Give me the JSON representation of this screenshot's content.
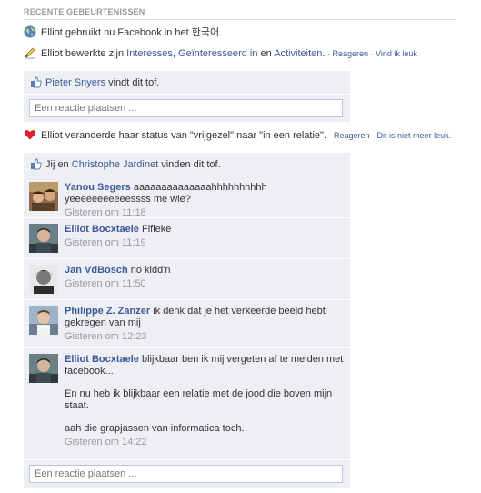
{
  "header": {
    "title": "RECENTE GEBEURTENISSEN"
  },
  "stories": {
    "facebook_language": {
      "text": "Elliot gebruikt nu Facebook in het 한국어."
    },
    "edit_interests": {
      "prefix": "Elliot bewerkte zijn ",
      "link1": "Interesses",
      "sep1": ", ",
      "link2": "Geïnteresseerd in",
      "sep2": " en ",
      "link3": "Activiteiten",
      "end": ".",
      "dot1": " · ",
      "action1": "Reageren",
      "dot2": " · ",
      "action2": "Vind ik leuk"
    },
    "relationship": {
      "text": "Elliot veranderde haar status van \"vrijgezel\" naar \"in een relatie\".",
      "dot1": " · ",
      "action1": "Reageren",
      "dot2": " · ",
      "action2": "Dit is niet meer leuk."
    }
  },
  "ufi1": {
    "like_name": "Pieter Snyers",
    "like_suffix": " vindt dit tof.",
    "input_placeholder": "Een reactie plaatsen ..."
  },
  "ufi2": {
    "like_prefix": "Jij en ",
    "like_name": "Christophe Jardinet",
    "like_suffix": " vinden dit tof.",
    "input_placeholder": "Een reactie plaatsen ...",
    "comments": [
      {
        "name": "Yanou Segers",
        "text": "aaaaaaaaaaaaaahhhhhhhhhh yeeeeeeeeeeessss me wie?",
        "time": "Gisteren om 11:18"
      },
      {
        "name": "Elliot Bocxtaele",
        "text": "Fifieke",
        "time": "Gisteren om 11:19"
      },
      {
        "name": "Jan VdBosch",
        "text": "no kidd'n",
        "time": "Gisteren om 11:50"
      },
      {
        "name": "Philippe Z. Zanzer",
        "text": "ik denk dat je het verkeerde beeld hebt gekregen van mij",
        "time": "Gisteren om 12:23"
      },
      {
        "name": "Elliot Bocxtaele",
        "text": "blijkbaar ben ik mij vergeten af te melden met facebook...",
        "para2": "En nu heb ik blijkbaar een relatie met de jood die boven mijn staat.",
        "para3": "aah die grapjassen van informatica toch.",
        "time": "Gisteren om 14:22"
      }
    ]
  },
  "icons": {
    "globe": "globe-icon",
    "pencil": "pencil-icon",
    "heart": "heart-icon",
    "thumb": "thumbs-up-icon"
  },
  "colors": {
    "link": "#3b5998",
    "ufi_bg": "#edeff4",
    "heart": "#d8232a"
  }
}
